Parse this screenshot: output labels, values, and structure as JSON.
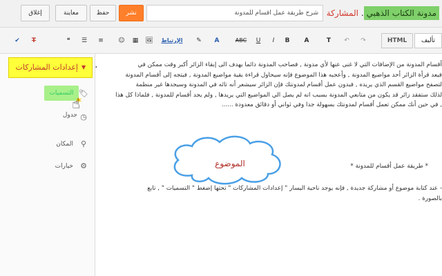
{
  "header": {
    "blog_name": "مدونة الكتاب الذهبي",
    "separator": ".",
    "section": "المشاركة",
    "title_value": "شرح طريقة عمل اقسام للمدونة",
    "buttons": {
      "publish": "نشر",
      "save": "حفظ",
      "preview": "معاينة",
      "close": "إغلاق"
    }
  },
  "toolbar": {
    "mode_compose": "تأليف",
    "mode_html": "HTML",
    "link_label": "الإرتباط",
    "tools": [
      "↶",
      "↷",
      "T",
      "A",
      "B",
      "I",
      "U",
      "ABC",
      "A",
      "✎",
      "🖼",
      "▦",
      "☺",
      "≡",
      "☰",
      "❝",
      "T",
      "✔"
    ]
  },
  "sidepanel": {
    "settings_title": "إعدادات المشاركات",
    "rows": {
      "labels": "التسميات",
      "schedule": "جدول زمني",
      "location": "المكان",
      "options": "خيارات"
    }
  },
  "editor": {
    "lines_p1": [
      "أقسام المدونة من الإضافات التي لا غنى عنها لأي مدونة , فصاحب المدونة دائما يهدف الى إبقاء الزائر أكبر وقت ممكن في",
      "فيعد قرأة الزائر أحد مواضيع المدونة , وأعجبه هذا الموضوع فإنه سيحاول قراءة بقية مواضيع المدونة , فيتجه إلى أقسام المدونة",
      "لتصفح مواضيع القسم الذي يريده , فبدون عمل أقسام لمدونتك فإن الزائر سيشعر أنه تائه في المدونة وسيجدها غير منظمة",
      "لذلك ستفقد زائر قد يكون من متابعي المدونة بسبب انه لم يصل الي المواضيع التي يريدها , ولم يجد أقسام للمدونة , فلماذا كل هذا",
      ", في حين أنك ممكن تعمل أقسام لمدونتك بسهولة جدا وفي ثواني أو دقائق معدودة ......"
    ],
    "subheading": "* طريقة عمل أقسام للمدونة *",
    "lines_p2": [
      "- عند كتابة موضوع أو مشاركة جديدة , فإنه يوجد ناحية اليسار \" إعدادات المشاركات \" تحتها إضغط \" التسميات \" , تابع",
      "بالصورة ."
    ],
    "cloud_label": "الموضوع"
  },
  "colors": {
    "publish": "#ff7f2a",
    "blog_name_bg": "#7fd06a",
    "settings_bg": "#ffff3a",
    "labels_highlight": "#a8f08a",
    "accent_red": "#d2372c"
  }
}
